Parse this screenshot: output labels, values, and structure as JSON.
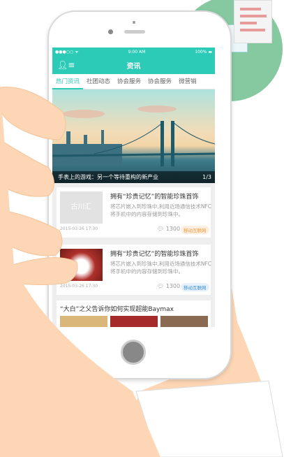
{
  "status": {
    "time": "9:00 AM",
    "battery": "100%"
  },
  "header": {
    "title": "资讯"
  },
  "tabs": [
    {
      "label": "热门资讯"
    },
    {
      "label": "社团动态"
    },
    {
      "label": "协会服务"
    },
    {
      "label": "协会服务"
    },
    {
      "label": "微营销"
    }
  ],
  "banner": {
    "caption": "手表上的游戏：另一个等待重构的新产业",
    "pager": "1/3"
  },
  "articles": [
    {
      "title": "拥有“珍贵记忆”的智能珍珠首饰",
      "desc": "将芯片嵌入到珍珠中,利用近场通信技术NFC将手机中的内容存储到珍珠中。",
      "date": "2015-03-26 17:30",
      "comments": "1300",
      "tag": "移动互联网",
      "tag_color": "#f39a3c",
      "thumb_logo": "古川汇"
    },
    {
      "title": "拥有“珍贵记忆”的智能珍珠首饰",
      "desc": "将芯片嵌入到珍珠中,利用近场通信技术NFC将手机中的内容存储到珍珠中。",
      "date": "2015-03-26 17:30",
      "comments": "1300",
      "tag": "移动互联网",
      "tag_color": "#3a8fd6"
    }
  ],
  "feature": {
    "title": "“大白”之父告诉你如何实现超能Baymax"
  },
  "colors": {
    "accent": "#2ccbb8",
    "skin": "#fdd6b5",
    "circle": "#86c9a0"
  }
}
